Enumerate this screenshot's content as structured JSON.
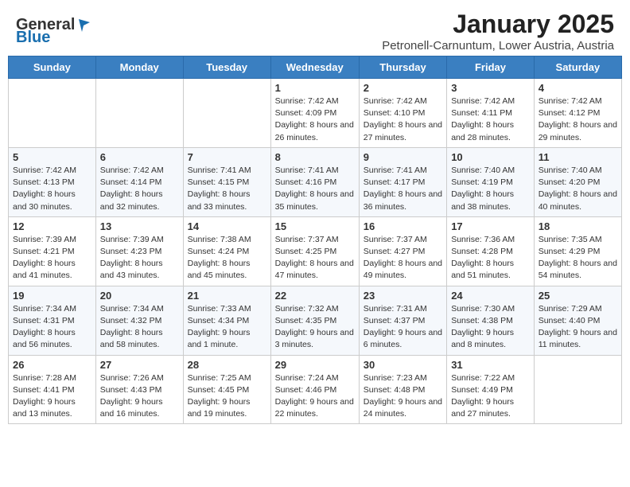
{
  "header": {
    "logo_general": "General",
    "logo_blue": "Blue",
    "month_title": "January 2025",
    "subtitle": "Petronell-Carnuntum, Lower Austria, Austria"
  },
  "weekdays": [
    "Sunday",
    "Monday",
    "Tuesday",
    "Wednesday",
    "Thursday",
    "Friday",
    "Saturday"
  ],
  "weeks": [
    [
      {
        "day": "",
        "info": ""
      },
      {
        "day": "",
        "info": ""
      },
      {
        "day": "",
        "info": ""
      },
      {
        "day": "1",
        "info": "Sunrise: 7:42 AM\nSunset: 4:09 PM\nDaylight: 8 hours and 26 minutes."
      },
      {
        "day": "2",
        "info": "Sunrise: 7:42 AM\nSunset: 4:10 PM\nDaylight: 8 hours and 27 minutes."
      },
      {
        "day": "3",
        "info": "Sunrise: 7:42 AM\nSunset: 4:11 PM\nDaylight: 8 hours and 28 minutes."
      },
      {
        "day": "4",
        "info": "Sunrise: 7:42 AM\nSunset: 4:12 PM\nDaylight: 8 hours and 29 minutes."
      }
    ],
    [
      {
        "day": "5",
        "info": "Sunrise: 7:42 AM\nSunset: 4:13 PM\nDaylight: 8 hours and 30 minutes."
      },
      {
        "day": "6",
        "info": "Sunrise: 7:42 AM\nSunset: 4:14 PM\nDaylight: 8 hours and 32 minutes."
      },
      {
        "day": "7",
        "info": "Sunrise: 7:41 AM\nSunset: 4:15 PM\nDaylight: 8 hours and 33 minutes."
      },
      {
        "day": "8",
        "info": "Sunrise: 7:41 AM\nSunset: 4:16 PM\nDaylight: 8 hours and 35 minutes."
      },
      {
        "day": "9",
        "info": "Sunrise: 7:41 AM\nSunset: 4:17 PM\nDaylight: 8 hours and 36 minutes."
      },
      {
        "day": "10",
        "info": "Sunrise: 7:40 AM\nSunset: 4:19 PM\nDaylight: 8 hours and 38 minutes."
      },
      {
        "day": "11",
        "info": "Sunrise: 7:40 AM\nSunset: 4:20 PM\nDaylight: 8 hours and 40 minutes."
      }
    ],
    [
      {
        "day": "12",
        "info": "Sunrise: 7:39 AM\nSunset: 4:21 PM\nDaylight: 8 hours and 41 minutes."
      },
      {
        "day": "13",
        "info": "Sunrise: 7:39 AM\nSunset: 4:23 PM\nDaylight: 8 hours and 43 minutes."
      },
      {
        "day": "14",
        "info": "Sunrise: 7:38 AM\nSunset: 4:24 PM\nDaylight: 8 hours and 45 minutes."
      },
      {
        "day": "15",
        "info": "Sunrise: 7:37 AM\nSunset: 4:25 PM\nDaylight: 8 hours and 47 minutes."
      },
      {
        "day": "16",
        "info": "Sunrise: 7:37 AM\nSunset: 4:27 PM\nDaylight: 8 hours and 49 minutes."
      },
      {
        "day": "17",
        "info": "Sunrise: 7:36 AM\nSunset: 4:28 PM\nDaylight: 8 hours and 51 minutes."
      },
      {
        "day": "18",
        "info": "Sunrise: 7:35 AM\nSunset: 4:29 PM\nDaylight: 8 hours and 54 minutes."
      }
    ],
    [
      {
        "day": "19",
        "info": "Sunrise: 7:34 AM\nSunset: 4:31 PM\nDaylight: 8 hours and 56 minutes."
      },
      {
        "day": "20",
        "info": "Sunrise: 7:34 AM\nSunset: 4:32 PM\nDaylight: 8 hours and 58 minutes."
      },
      {
        "day": "21",
        "info": "Sunrise: 7:33 AM\nSunset: 4:34 PM\nDaylight: 9 hours and 1 minute."
      },
      {
        "day": "22",
        "info": "Sunrise: 7:32 AM\nSunset: 4:35 PM\nDaylight: 9 hours and 3 minutes."
      },
      {
        "day": "23",
        "info": "Sunrise: 7:31 AM\nSunset: 4:37 PM\nDaylight: 9 hours and 6 minutes."
      },
      {
        "day": "24",
        "info": "Sunrise: 7:30 AM\nSunset: 4:38 PM\nDaylight: 9 hours and 8 minutes."
      },
      {
        "day": "25",
        "info": "Sunrise: 7:29 AM\nSunset: 4:40 PM\nDaylight: 9 hours and 11 minutes."
      }
    ],
    [
      {
        "day": "26",
        "info": "Sunrise: 7:28 AM\nSunset: 4:41 PM\nDaylight: 9 hours and 13 minutes."
      },
      {
        "day": "27",
        "info": "Sunrise: 7:26 AM\nSunset: 4:43 PM\nDaylight: 9 hours and 16 minutes."
      },
      {
        "day": "28",
        "info": "Sunrise: 7:25 AM\nSunset: 4:45 PM\nDaylight: 9 hours and 19 minutes."
      },
      {
        "day": "29",
        "info": "Sunrise: 7:24 AM\nSunset: 4:46 PM\nDaylight: 9 hours and 22 minutes."
      },
      {
        "day": "30",
        "info": "Sunrise: 7:23 AM\nSunset: 4:48 PM\nDaylight: 9 hours and 24 minutes."
      },
      {
        "day": "31",
        "info": "Sunrise: 7:22 AM\nSunset: 4:49 PM\nDaylight: 9 hours and 27 minutes."
      },
      {
        "day": "",
        "info": ""
      }
    ]
  ]
}
